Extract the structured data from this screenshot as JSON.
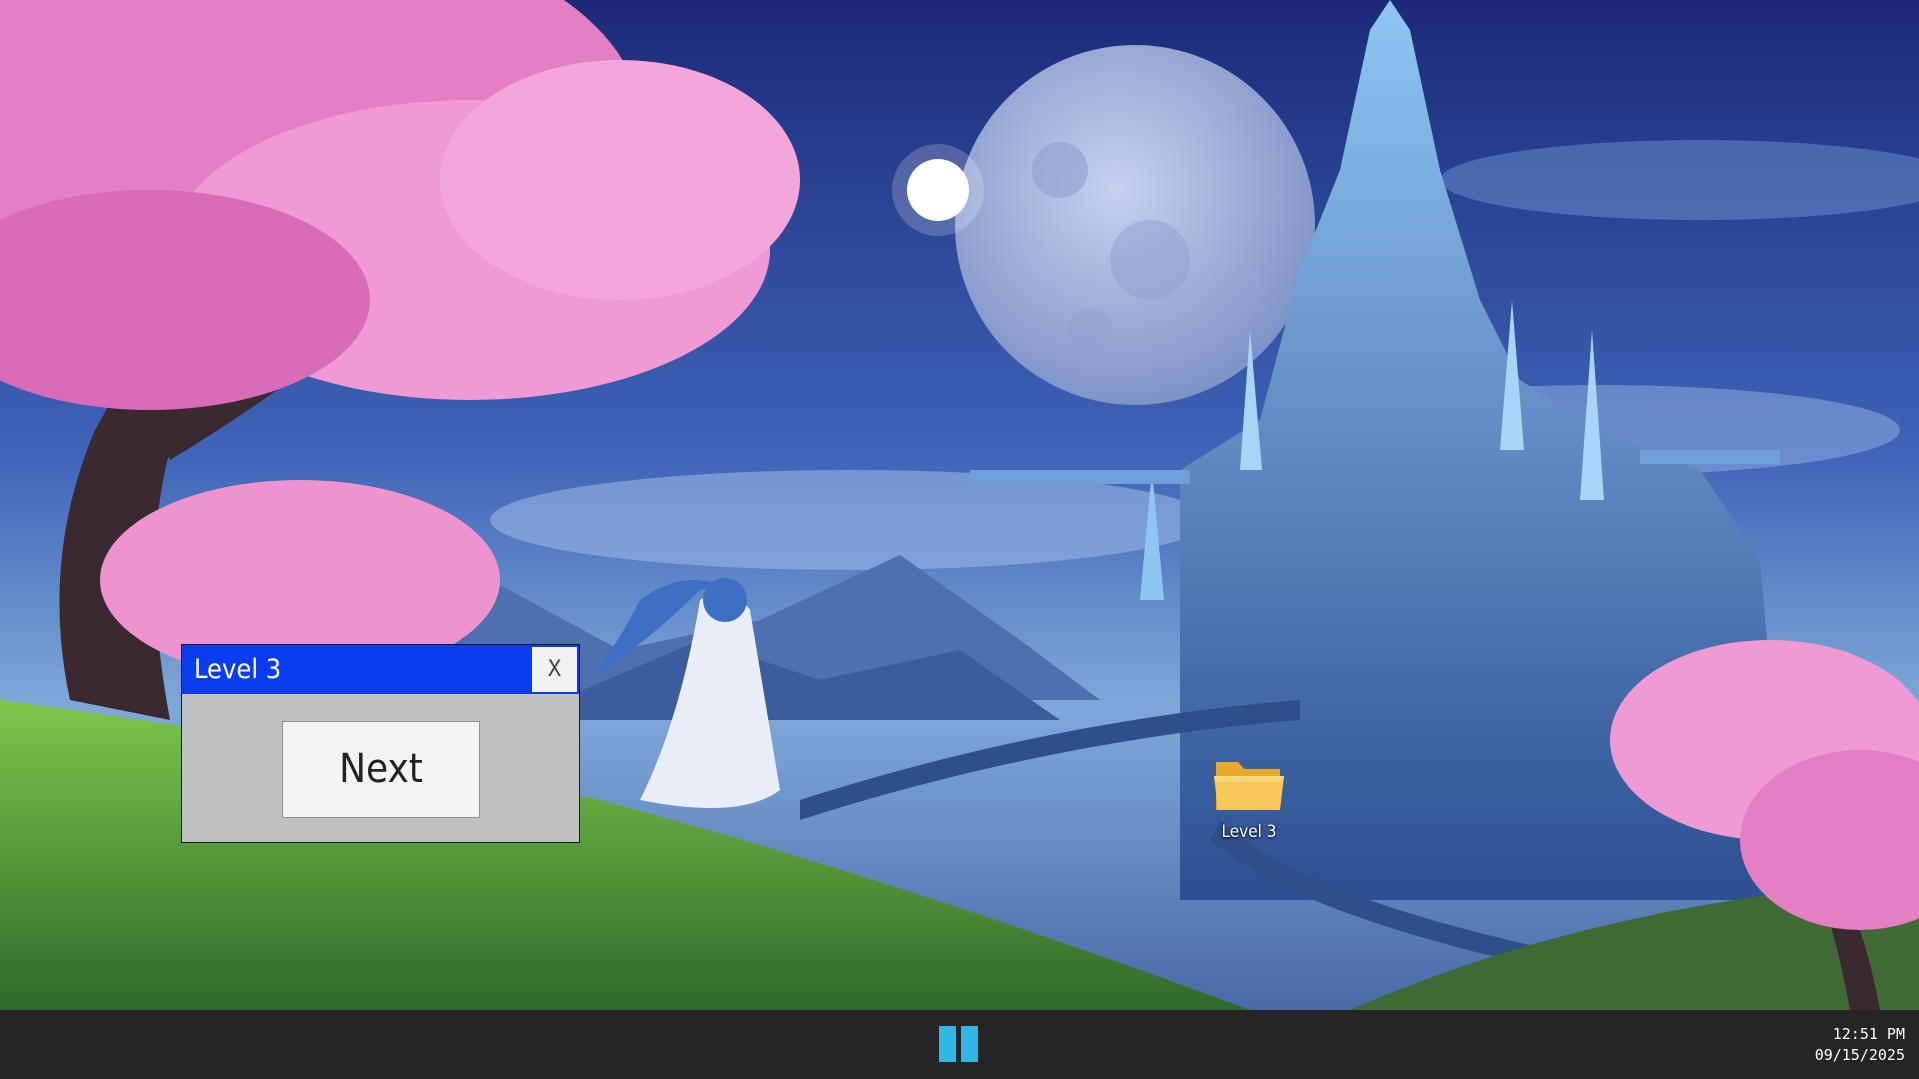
{
  "dialog": {
    "title": "Level 3",
    "close_label": "X",
    "next_label": "Next"
  },
  "desktop": {
    "icons": [
      {
        "label": "Level 3",
        "icon": "folder-icon"
      }
    ]
  },
  "taskbar": {
    "start_icon": "two-bars-start-icon",
    "time": "12:51 PM",
    "date": "09/15/2025"
  },
  "colors": {
    "titlebar": "#0a3df0",
    "dialog_bg": "#c1c1c1",
    "taskbar_bg": "#252525",
    "start_accent": "#2fb8e6",
    "folder": "#f4c24e"
  }
}
